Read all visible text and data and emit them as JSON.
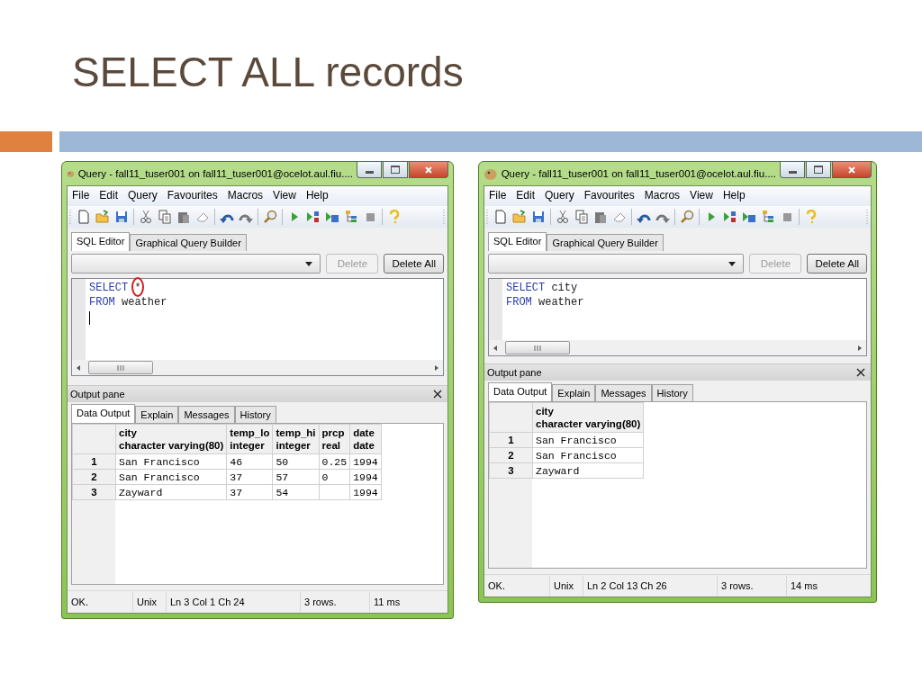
{
  "slide": {
    "title": "SELECT ALL records"
  },
  "windows": [
    {
      "title": "Query - fall11_tuser001 on fall11_tuser001@ocelot.aul.fiu....",
      "menu": [
        "File",
        "Edit",
        "Query",
        "Favourites",
        "Macros",
        "View",
        "Help"
      ],
      "editor_tabs": [
        {
          "label": "SQL Editor",
          "selected": true
        },
        {
          "label": "Graphical Query Builder",
          "selected": false
        }
      ],
      "buttons": [
        {
          "label": "Delete",
          "disabled": true
        },
        {
          "label": "Delete All",
          "disabled": false
        }
      ],
      "sql_lines": [
        {
          "tokens": [
            {
              "text": "SELECT",
              "kind": "keyword"
            },
            {
              "text": "*",
              "kind": "plain",
              "circled": true
            }
          ]
        },
        {
          "tokens": [
            {
              "text": "FROM",
              "kind": "keyword"
            },
            {
              "text": "weather",
              "kind": "plain"
            }
          ]
        }
      ],
      "caret": true,
      "output": {
        "title": "Output pane",
        "tabs": [
          {
            "label": "Data Output",
            "selected": true
          },
          {
            "label": "Explain",
            "selected": false
          },
          {
            "label": "Messages",
            "selected": false
          },
          {
            "label": "History",
            "selected": false
          }
        ],
        "columns": [
          {
            "name": "city",
            "type": "character varying(80)"
          },
          {
            "name": "temp_lo",
            "type": "integer"
          },
          {
            "name": "temp_hi",
            "type": "integer"
          },
          {
            "name": "prcp",
            "type": "real"
          },
          {
            "name": "date",
            "type": "date"
          }
        ],
        "rows": [
          {
            "number": "1",
            "cells": [
              "San Francisco",
              "46",
              "50",
              "0.25",
              "1994"
            ]
          },
          {
            "number": "2",
            "cells": [
              "San Francisco",
              "37",
              "57",
              "0",
              "1994"
            ]
          },
          {
            "number": "3",
            "cells": [
              "Zayward",
              "37",
              "54",
              null,
              "1994"
            ]
          }
        ]
      },
      "status": [
        "OK.",
        "Unix",
        "Ln 3 Col 1 Ch 24",
        "3 rows.",
        "11 ms"
      ]
    },
    {
      "title": "Query - fall11_tuser001 on fall11_tuser001@ocelot.aul.fiu....",
      "menu": [
        "File",
        "Edit",
        "Query",
        "Favourites",
        "Macros",
        "View",
        "Help"
      ],
      "editor_tabs": [
        {
          "label": "SQL Editor",
          "selected": true
        },
        {
          "label": "Graphical Query Builder",
          "selected": false
        }
      ],
      "buttons": [
        {
          "label": "Delete",
          "disabled": true
        },
        {
          "label": "Delete All",
          "disabled": false
        }
      ],
      "sql_lines": [
        {
          "tokens": [
            {
              "text": "SELECT",
              "kind": "keyword"
            },
            {
              "text": "city",
              "kind": "plain"
            }
          ]
        },
        {
          "tokens": [
            {
              "text": "FROM",
              "kind": "keyword"
            },
            {
              "text": "weather",
              "kind": "plain"
            }
          ]
        }
      ],
      "caret": false,
      "output": {
        "title": "Output pane",
        "tabs": [
          {
            "label": "Data Output",
            "selected": true
          },
          {
            "label": "Explain",
            "selected": false
          },
          {
            "label": "Messages",
            "selected": false
          },
          {
            "label": "History",
            "selected": false
          }
        ],
        "columns": [
          {
            "name": "city",
            "type": "character varying(80)"
          }
        ],
        "rows": [
          {
            "number": "1",
            "cells": [
              "San Francisco"
            ]
          },
          {
            "number": "2",
            "cells": [
              "San Francisco"
            ]
          },
          {
            "number": "3",
            "cells": [
              "Zayward"
            ]
          }
        ]
      },
      "status": [
        "OK.",
        "Unix",
        "Ln 2 Col 13 Ch 26",
        "3 rows.",
        "14 ms"
      ]
    }
  ]
}
